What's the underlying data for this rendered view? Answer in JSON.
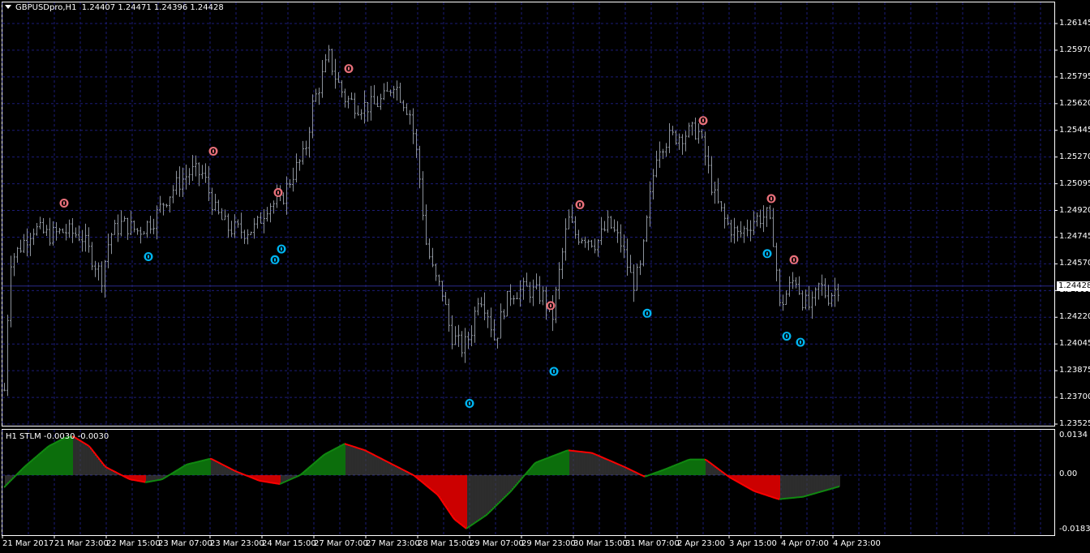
{
  "window": {
    "symbol_label": "GBPUSDpro,H1",
    "ohlc": "1.24407 1.24471 1.24396 1.24428"
  },
  "indicator": {
    "label": "H1 STLM -0.0030 -0.0030",
    "axis_labels": [
      "0.0134",
      "0.00",
      "-0.0183"
    ],
    "ylim": [
      -0.0183,
      0.0134
    ]
  },
  "price_axis": {
    "labels": [
      "1.26145",
      "1.25970",
      "1.25795",
      "1.25620",
      "1.25445",
      "1.25270",
      "1.25095",
      "1.24920",
      "1.24745",
      "1.24570",
      "1.24395",
      "1.24220",
      "1.24045",
      "1.23875",
      "1.23700",
      "1.23525"
    ],
    "current_price": "1.24428",
    "ylim": [
      1.23525,
      1.26145
    ]
  },
  "time_axis": {
    "labels": [
      "21 Mar 2017",
      "21 Mar 23:00",
      "22 Mar 15:00",
      "23 Mar 07:00",
      "23 Mar 23:00",
      "24 Mar 15:00",
      "27 Mar 07:00",
      "27 Mar 23:00",
      "28 Mar 15:00",
      "29 Mar 07:00",
      "29 Mar 23:00",
      "30 Mar 15:00",
      "31 Mar 07:00",
      "2 Apr 23:00",
      "3 Apr 15:00",
      "4 Apr 07:00",
      "4 Apr 23:00"
    ]
  },
  "colors": {
    "background": "#000000",
    "bars": "#8c929b",
    "grid": "#1c1c78",
    "bid_line": "#2a2a8a",
    "up": "#108a10",
    "down": "#ff0000",
    "neutral_hist": "#808080",
    "signal_high": "#e8707a",
    "signal_low": "#00b4f0"
  },
  "chart_data": {
    "type": "ohlc-bar",
    "approx_close_path": [
      1.2375,
      1.246,
      1.2465,
      1.2481,
      1.2476,
      1.2479,
      1.2476,
      1.2465,
      1.2449,
      1.2476,
      1.2484,
      1.2479,
      1.2487,
      1.2497,
      1.2508,
      1.2518,
      1.2516,
      1.2492,
      1.2481,
      1.2479,
      1.2481,
      1.2497,
      1.2497,
      1.2516,
      1.2529,
      1.2561,
      1.2577,
      1.2593,
      1.2577,
      1.2566,
      1.2561,
      1.2561,
      1.2566,
      1.2577,
      1.2566,
      1.2556,
      1.2524,
      1.2471,
      1.2449,
      1.2439,
      1.2412,
      1.2402,
      1.2412,
      1.2439,
      1.2428,
      1.2407,
      1.2428,
      1.2439,
      1.2441,
      1.2436,
      1.242,
      1.2455,
      1.2487,
      1.2476,
      1.2476,
      1.2471,
      1.2484,
      1.2471,
      1.2444,
      1.2455,
      1.2497,
      1.2534,
      1.254,
      1.2542,
      1.2545,
      1.2526,
      1.2502,
      1.2484,
      1.2476,
      1.2487,
      1.2489,
      1.2471,
      1.2428,
      1.2439,
      1.2449,
      1.2433,
      1.2428,
      1.2444,
      1.2436,
      1.2444
    ],
    "stlm_path": [
      -0.0041,
      0.0028,
      0.0098,
      0.0126,
      0.0131,
      0.0098,
      0.0028,
      -0.0014,
      -0.0024,
      -0.0014,
      0.0036,
      0.0056,
      0.0014,
      -0.0019,
      -0.003,
      0.0,
      0.007,
      0.0106,
      0.0084,
      0.0042,
      0.0,
      -0.0067,
      -0.0148,
      -0.018,
      -0.0134,
      -0.0054,
      0.0042,
      0.0084,
      0.0075,
      0.0028,
      -0.0005,
      0.002,
      0.0053,
      0.0053,
      -0.0008,
      -0.0054,
      -0.0081,
      -0.0073,
      -0.0038
    ],
    "signals_high": [
      1.2497,
      1.2531,
      1.2504,
      1.2585,
      1.243,
      1.2496,
      1.2551,
      1.25,
      1.246
    ],
    "signals_low": [
      1.2462,
      1.246,
      1.2467,
      1.2366,
      1.2387,
      1.2425,
      1.2464,
      1.241,
      1.2406
    ],
    "signal_text": "0"
  }
}
